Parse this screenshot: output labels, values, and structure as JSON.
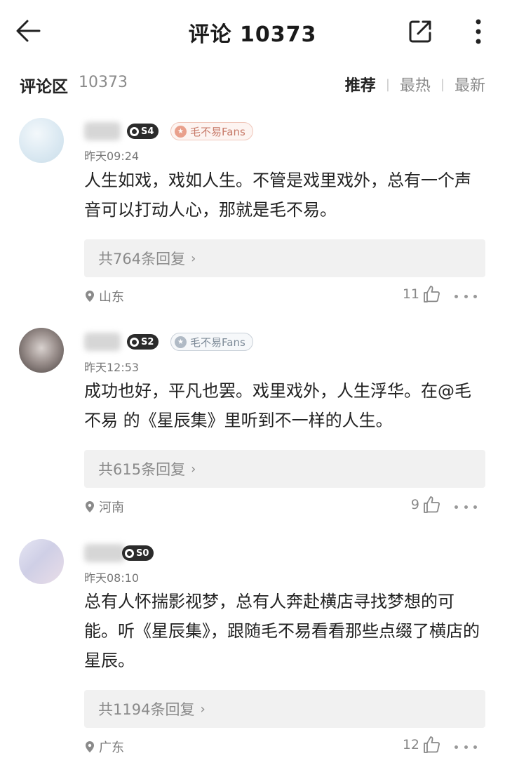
{
  "header": {
    "title": "评论 10373"
  },
  "section": {
    "title": "评论区",
    "count": "10373",
    "sort_options": [
      {
        "label": "推荐",
        "active": true
      },
      {
        "label": "最热",
        "active": false
      },
      {
        "label": "最新",
        "active": false
      }
    ]
  },
  "comments": [
    {
      "level": "S4",
      "fan_badge": "毛不易Fans",
      "time": "昨天09:24",
      "text": "人生如戏，戏如人生。不管是戏里戏外，总有一个声音可以打动人心，那就是毛不易。",
      "reply_label": "共764条回复",
      "location": "山东",
      "likes": "11"
    },
    {
      "level": "S2",
      "fan_badge": "毛不易Fans",
      "time": "昨天12:53",
      "text": "成功也好，平凡也罢。戏里戏外，人生浮华。在@毛不易 的《星辰集》里听到不一样的人生。",
      "reply_label": "共615条回复",
      "location": "河南",
      "likes": "9"
    },
    {
      "level": "S0",
      "time": "昨天08:10",
      "text": "总有人怀揣影视梦，总有人奔赴横店寻找梦想的可能。听《星辰集》，跟随毛不易看看那些点缀了横店的星辰。",
      "reply_label": "共1194条回复",
      "location": "广东",
      "likes": "12"
    }
  ],
  "icons": {
    "back": "arrow-left-icon",
    "share": "share-icon",
    "more": "more-vertical-icon",
    "location": "location-pin-icon",
    "like": "thumbs-up-icon",
    "options": "more-horizontal-icon"
  }
}
